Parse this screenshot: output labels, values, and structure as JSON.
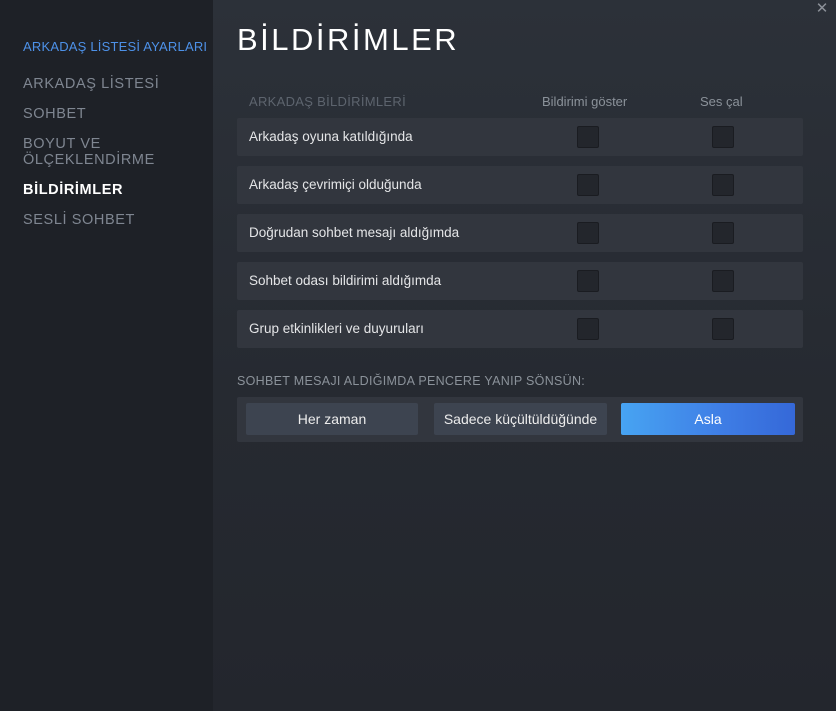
{
  "sidebar": {
    "header": "ARKADAŞ LİSTESİ AYARLARI",
    "items": [
      {
        "label": "ARKADAŞ LİSTESİ"
      },
      {
        "label": "SOHBET"
      },
      {
        "label": "BOYUT VE"
      },
      {
        "label": "ÖLÇEKLENDİRME"
      },
      {
        "label": "BİLDİRİMLER",
        "active": true
      },
      {
        "label": "SESLİ SOHBET"
      }
    ]
  },
  "window": {
    "close_glyph": "✕"
  },
  "page": {
    "title": "BİLDİRİMLER"
  },
  "notifications": {
    "section_label": "ARKADAŞ BİLDİRİMLERİ",
    "col_show": "Bildirimi göster",
    "col_sound": "Ses çal",
    "rows": [
      {
        "label": "Arkadaş oyuna katıldığında",
        "show": false,
        "sound": false
      },
      {
        "label": "Arkadaş çevrimiçi olduğunda",
        "show": false,
        "sound": false
      },
      {
        "label": "Doğrudan sohbet mesajı aldığımda",
        "show": false,
        "sound": false
      },
      {
        "label": "Sohbet odası bildirimi aldığımda",
        "show": false,
        "sound": false
      },
      {
        "label": "Grup etkinlikleri ve duyuruları",
        "show": false,
        "sound": false
      }
    ]
  },
  "flash": {
    "label": "SOHBET MESAJI ALDIĞIMDA PENCERE YANIP SÖNSÜN:",
    "options": [
      {
        "label": "Her zaman",
        "selected": false
      },
      {
        "label": "Sadece küçültüldüğünde",
        "selected": false
      },
      {
        "label": "Asla",
        "selected": true
      }
    ]
  },
  "colors": {
    "accent": "#4d91e8",
    "selected_button": "#3f7fe6",
    "background": "#23262e",
    "sidebar": "#1e2127"
  }
}
